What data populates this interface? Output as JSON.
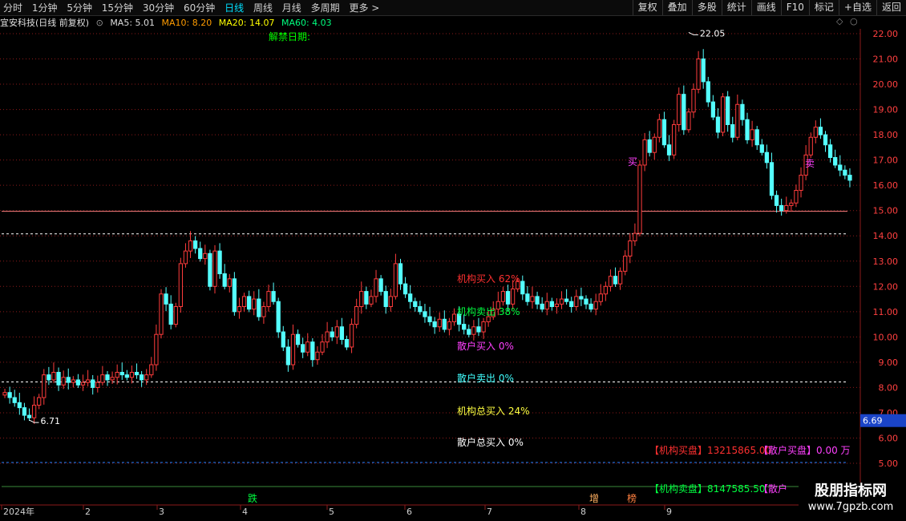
{
  "toolbar": {
    "periods": [
      "分时",
      "1分钟",
      "5分钟",
      "15分钟",
      "30分钟",
      "60分钟",
      "日线",
      "周线",
      "月线",
      "多周期",
      "更多 >"
    ],
    "active_period": "日线",
    "actions": [
      "复权",
      "叠加",
      "多股",
      "统计",
      "画线",
      "F10",
      "标记",
      "+自选",
      "返回"
    ]
  },
  "info": {
    "stock_title": "宜安科技(日线 前复权)",
    "ma5": "MA5: 5.01",
    "ma10": "MA10: 8.20",
    "ma20": "MA20: 14.07",
    "ma60": "MA60: 4.03",
    "unlock_label": "解禁日期:"
  },
  "colors": {
    "up": "#ff3c3c",
    "down": "#54ffff",
    "grid": "#8b1a1a",
    "axis": "#ff4040"
  },
  "chart_data": {
    "type": "candlestick",
    "ylim": [
      4.7,
      22.4
    ],
    "y_ticks": [
      5.0,
      6.0,
      7.0,
      8.0,
      9.0,
      10.0,
      11.0,
      12.0,
      13.0,
      14.0,
      15.0,
      16.0,
      17.0,
      18.0,
      19.0,
      20.0,
      21.0,
      22.0
    ],
    "x_labels": [
      "2024年",
      "2",
      "3",
      "4",
      "5",
      "6",
      "7",
      "8",
      "9"
    ],
    "current_price_label": "6.69",
    "current_price": 6.69,
    "high_marker": {
      "label": "22.05",
      "value": 22.05
    },
    "low_marker": {
      "label": "6.71",
      "value": 6.71
    },
    "hline_solid": 14.97,
    "hline_dashed": [
      14.08,
      8.22
    ],
    "close": [
      7.8,
      7.6,
      7.4,
      7.2,
      6.9,
      6.8,
      7.3,
      7.6,
      8.5,
      8.3,
      8.6,
      8.1,
      8.4,
      8.2,
      8.3,
      8.1,
      8.2,
      8.3,
      8.0,
      8.2,
      8.5,
      8.3,
      8.4,
      8.6,
      8.5,
      8.4,
      8.6,
      8.5,
      8.3,
      8.5,
      8.9,
      10.1,
      11.7,
      11.3,
      10.5,
      11.2,
      12.9,
      13.4,
      13.8,
      13.5,
      13.1,
      13.3,
      12.0,
      13.4,
      12.5,
      12.0,
      12.3,
      11.0,
      11.2,
      11.6,
      11.1,
      11.5,
      10.8,
      11.2,
      11.8,
      11.4,
      10.2,
      9.6,
      8.9,
      10.1,
      9.7,
      9.4,
      9.8,
      9.1,
      9.4,
      9.8,
      10.2,
      10.0,
      10.4,
      9.9,
      9.6,
      10.5,
      11.2,
      11.8,
      11.3,
      11.6,
      12.3,
      11.8,
      11.2,
      11.6,
      12.9,
      12.1,
      11.7,
      11.4,
      11.2,
      11.0,
      10.8,
      10.6,
      10.4,
      10.7,
      10.3,
      10.6,
      10.9,
      10.5,
      10.3,
      10.1,
      10.4,
      10.2,
      10.6,
      10.8,
      11.1,
      11.4,
      11.8,
      11.3,
      11.9,
      12.2,
      11.7,
      11.4,
      11.6,
      11.3,
      11.1,
      11.4,
      11.2,
      11.3,
      11.5,
      11.4,
      11.2,
      11.6,
      11.5,
      11.3,
      11.1,
      11.4,
      11.7,
      12.0,
      12.4,
      12.1,
      12.6,
      13.2,
      13.8,
      14.1,
      16.8,
      17.8,
      17.3,
      17.9,
      18.6,
      17.6,
      17.2,
      18.4,
      19.6,
      18.2,
      18.9,
      19.8,
      21.0,
      20.1,
      19.3,
      18.7,
      18.1,
      19.5,
      18.4,
      17.9,
      19.2,
      18.6,
      17.8,
      18.2,
      17.6,
      17.3,
      16.9,
      15.6,
      15.2,
      15.0,
      15.2,
      15.3,
      15.8,
      16.4,
      17.2,
      17.9,
      18.3,
      18.0,
      17.6,
      17.1,
      16.8,
      16.6,
      16.4,
      16.2
    ],
    "annotations": {
      "inst_buy": "机构买入 62%",
      "inst_sell": "机构卖出 38%",
      "retail_buy": "散户买入 0%",
      "retail_sell": "散户卖出 0%",
      "inst_total_buy": "机构总买入 24%",
      "retail_total_buy": "散户总买入 0%",
      "inst_buy_disk": "【机构买盘】13215865.00",
      "retail_buy_disk": "【散户买盘】0.00 万",
      "inst_sell_disk": "【机构卖盘】8147585.50",
      "retail_sell_disk": "【散户",
      "sig_die": "跌",
      "sig_zeng": "增",
      "sig_bang": "榜",
      "sig_buy": "买",
      "sig_sell": "卖"
    }
  },
  "watermark": {
    "line1": "股朋指标网",
    "line2": "www.7gpzb.com"
  }
}
